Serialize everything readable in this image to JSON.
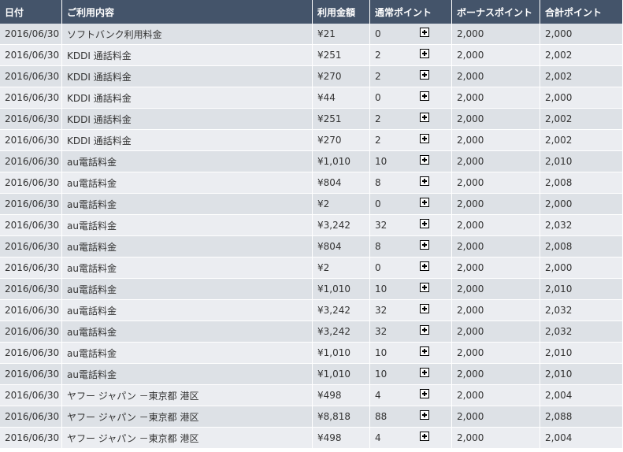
{
  "table": {
    "headers": [
      "日付",
      "ご利用内容",
      "利用金額",
      "通常ポイント",
      "ボーナスポイント",
      "合計ポイント"
    ],
    "rows": [
      {
        "date": "2016/06/30",
        "item": "ソフトバンク利用料金",
        "amount": "¥21",
        "normal": "0",
        "bonus": "2,000",
        "total": "2,000"
      },
      {
        "date": "2016/06/30",
        "item": "KDDI 通話料金",
        "amount": "¥251",
        "normal": "2",
        "bonus": "2,000",
        "total": "2,002"
      },
      {
        "date": "2016/06/30",
        "item": "KDDI 通話料金",
        "amount": "¥270",
        "normal": "2",
        "bonus": "2,000",
        "total": "2,002"
      },
      {
        "date": "2016/06/30",
        "item": "KDDI 通話料金",
        "amount": "¥44",
        "normal": "0",
        "bonus": "2,000",
        "total": "2,000"
      },
      {
        "date": "2016/06/30",
        "item": "KDDI 通話料金",
        "amount": "¥251",
        "normal": "2",
        "bonus": "2,000",
        "total": "2,002"
      },
      {
        "date": "2016/06/30",
        "item": "KDDI 通話料金",
        "amount": "¥270",
        "normal": "2",
        "bonus": "2,000",
        "total": "2,002"
      },
      {
        "date": "2016/06/30",
        "item": "au電話料金",
        "amount": "¥1,010",
        "normal": "10",
        "bonus": "2,000",
        "total": "2,010"
      },
      {
        "date": "2016/06/30",
        "item": "au電話料金",
        "amount": "¥804",
        "normal": "8",
        "bonus": "2,000",
        "total": "2,008"
      },
      {
        "date": "2016/06/30",
        "item": "au電話料金",
        "amount": "¥2",
        "normal": "0",
        "bonus": "2,000",
        "total": "2,000"
      },
      {
        "date": "2016/06/30",
        "item": "au電話料金",
        "amount": "¥3,242",
        "normal": "32",
        "bonus": "2,000",
        "total": "2,032"
      },
      {
        "date": "2016/06/30",
        "item": "au電話料金",
        "amount": "¥804",
        "normal": "8",
        "bonus": "2,000",
        "total": "2,008"
      },
      {
        "date": "2016/06/30",
        "item": "au電話料金",
        "amount": "¥2",
        "normal": "0",
        "bonus": "2,000",
        "total": "2,000"
      },
      {
        "date": "2016/06/30",
        "item": "au電話料金",
        "amount": "¥1,010",
        "normal": "10",
        "bonus": "2,000",
        "total": "2,010"
      },
      {
        "date": "2016/06/30",
        "item": "au電話料金",
        "amount": "¥3,242",
        "normal": "32",
        "bonus": "2,000",
        "total": "2,032"
      },
      {
        "date": "2016/06/30",
        "item": "au電話料金",
        "amount": "¥3,242",
        "normal": "32",
        "bonus": "2,000",
        "total": "2,032"
      },
      {
        "date": "2016/06/30",
        "item": "au電話料金",
        "amount": "¥1,010",
        "normal": "10",
        "bonus": "2,000",
        "total": "2,010"
      },
      {
        "date": "2016/06/30",
        "item": "au電話料金",
        "amount": "¥1,010",
        "normal": "10",
        "bonus": "2,000",
        "total": "2,010"
      },
      {
        "date": "2016/06/30",
        "item": "ヤフー ジャパン －東京都 港区",
        "amount": "¥498",
        "normal": "4",
        "bonus": "2,000",
        "total": "2,004"
      },
      {
        "date": "2016/06/30",
        "item": "ヤフー ジャパン －東京都 港区",
        "amount": "¥8,818",
        "normal": "88",
        "bonus": "2,000",
        "total": "2,088"
      },
      {
        "date": "2016/06/30",
        "item": "ヤフー ジャパン －東京都 港区",
        "amount": "¥498",
        "normal": "4",
        "bonus": "2,000",
        "total": "2,004"
      }
    ]
  },
  "icons": {
    "expand": "plus-box-icon"
  },
  "colors": {
    "header_bg": "#44546a",
    "header_text": "#ffffff",
    "row_odd": "#dde1e6",
    "row_even": "#ebedf1",
    "cell_text": "#333333"
  }
}
